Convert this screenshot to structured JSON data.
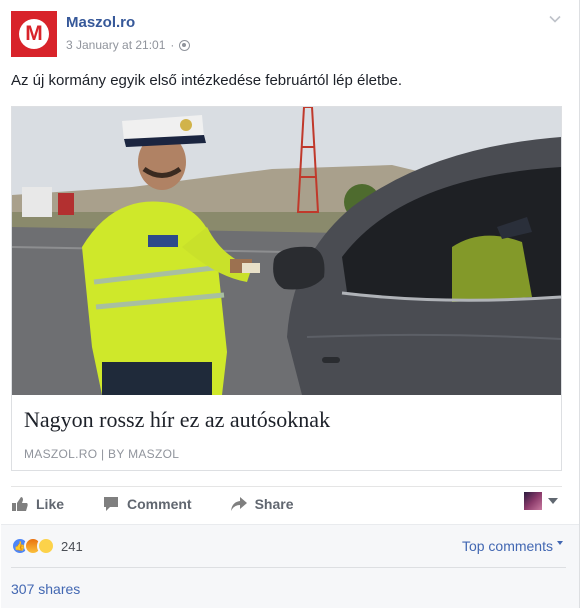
{
  "post": {
    "page_name": "Maszol.ro",
    "avatar_letter": "M",
    "timestamp": "3 January at 21:01",
    "separator": "·",
    "text": "Az új kormány egyik első intézkedése februártól lép életbe."
  },
  "link_card": {
    "title": "Nagyon rossz hír ez az autósoknak",
    "domain": "MASZOL.RO | BY MASZOL",
    "image_alt": "Police officer in high-visibility yellow jacket taking documents from a driver in a grey car"
  },
  "actions": {
    "like": "Like",
    "comment": "Comment",
    "share": "Share"
  },
  "footer": {
    "reaction_count": "241",
    "top_comments": "Top comments",
    "shares": "307 shares"
  },
  "colors": {
    "link_blue": "#365899",
    "brand_red": "#d8232a",
    "footer_bg": "#f6f7f9"
  }
}
